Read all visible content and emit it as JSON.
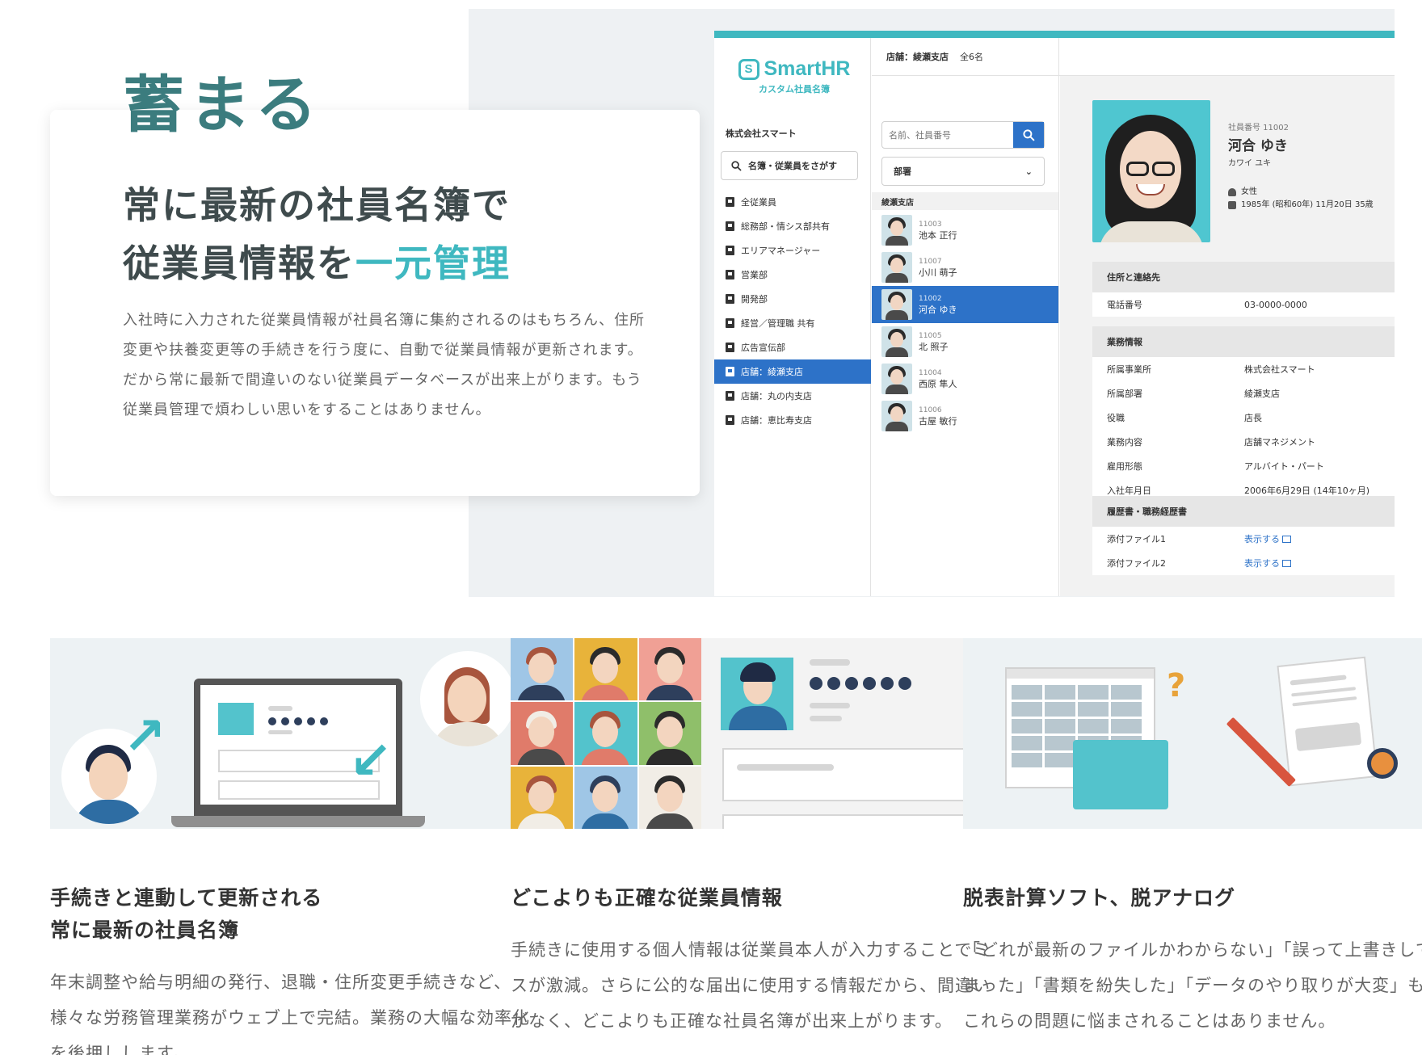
{
  "hero": {
    "eyebrow": "蓄まる",
    "title_line1": "常に最新の社員名簿で",
    "title_line2_plain": "従業員情報を",
    "title_line2_accent": "一元管理",
    "description": "入社時に入力された従業員情報が社員名簿に集約されるのはもちろん、住所変更や扶養変更等の手続きを行う度に、自動で従業員情報が更新されます。だから常に最新で間違いのない従業員データベースが出来上がります。もう従業員管理で煩わしい思いをすることはありません。"
  },
  "app": {
    "logo_main": "SmartHR",
    "logo_sub": "カスタム社員名簿",
    "company": "株式会社スマート",
    "sidebar_search_label": "名簿・従業員をさがす",
    "sidebar_items": [
      "全従業員",
      "総務部・情シス部共有",
      "エリアマネージャー",
      "営業部",
      "開発部",
      "経営／管理職 共有",
      "広告宣伝部",
      "店舗：綾瀬支店",
      "店舗：丸の内支店",
      "店舗：恵比寿支店"
    ],
    "active_sidebar_index": 7,
    "topbar_title": "店舗：綾瀬支店",
    "topbar_count": "全6名",
    "employee_search_placeholder": "名前、社員番号",
    "department_select": "部署",
    "group_header": "綾瀬支店",
    "employees": [
      {
        "no": "11003",
        "name": "池本 正行"
      },
      {
        "no": "11007",
        "name": "小川 萌子"
      },
      {
        "no": "11002",
        "name": "河合 ゆき"
      },
      {
        "no": "11005",
        "name": "北 照子"
      },
      {
        "no": "11004",
        "name": "西原 隼人"
      },
      {
        "no": "11006",
        "name": "古屋 敏行"
      }
    ],
    "active_employee_index": 2,
    "profile": {
      "number_label": "社員番号 11002",
      "name": "河合 ゆき",
      "kana": "カワイ ユキ",
      "gender": "女性",
      "birth": "1985年 (昭和60年) 11月20日 35歳"
    },
    "sections": [
      {
        "title": "住所と連絡先",
        "rows": [
          {
            "k": "電話番号",
            "v": "03-0000-0000"
          }
        ]
      },
      {
        "title": "業務情報",
        "rows": [
          {
            "k": "所属事業所",
            "v": "株式会社スマート"
          },
          {
            "k": "所属部署",
            "v": "綾瀬支店"
          },
          {
            "k": "役職",
            "v": "店長"
          },
          {
            "k": "業務内容",
            "v": "店舗マネジメント"
          },
          {
            "k": "雇用形態",
            "v": "アルバイト・パート"
          },
          {
            "k": "入社年月日",
            "v": "2006年6月29日 (14年10ヶ月)"
          }
        ]
      },
      {
        "title": "履歴書・職務経歴書",
        "rows": [
          {
            "k": "添付ファイル1",
            "v": "表示する"
          },
          {
            "k": "添付ファイル2",
            "v": "表示する"
          }
        ]
      }
    ]
  },
  "features": [
    {
      "title_line1": "手続きと連動して更新される",
      "title_line2": "常に最新の社員名簿",
      "description": "年末調整や給与明細の発行、退職・住所変更手続きなど、様々な労務管理業務がウェブ上で完結。業務の大幅な効率化を後押しします。"
    },
    {
      "title_line1": "どこよりも正確な従業員情報",
      "title_line2": "",
      "description": "手続きに使用する個人情報は従業員本人が入力することでミスが激減。さらに公的な届出に使用する情報だから、間違いがなく、どこよりも正確な社員名簿が出来上がります。"
    },
    {
      "title_line1": "脱表計算ソフト、脱アナログ",
      "title_line2": "",
      "description": "「どれが最新のファイルかわからない」「誤って上書きしてしまった」「書類を紛失した」「データのやり取りが大変」もうこれらの問題に悩まされることはありません。"
    }
  ],
  "colors": {
    "accent_teal": "#3fb8c0",
    "heading_teal": "#3b7c7e",
    "selection_blue": "#2d72c8"
  }
}
